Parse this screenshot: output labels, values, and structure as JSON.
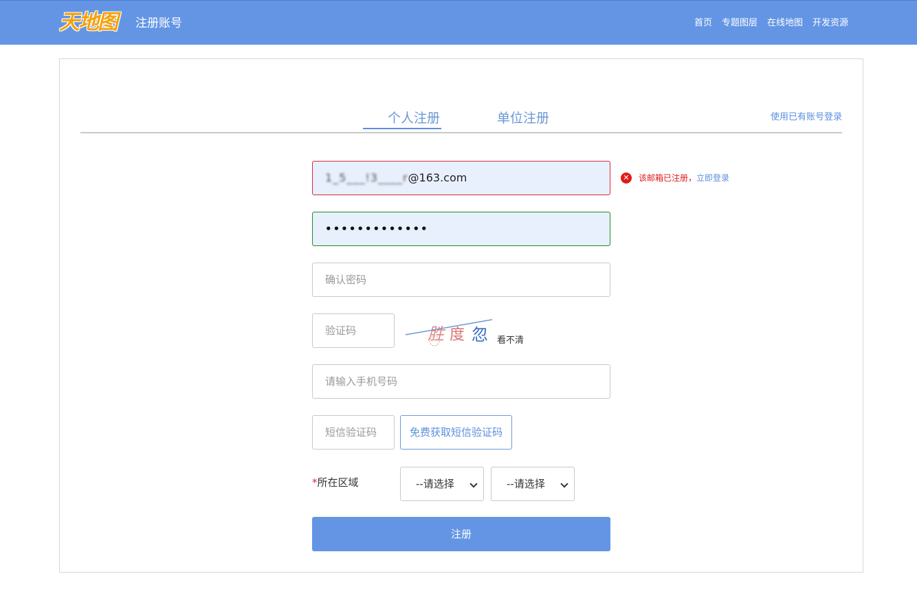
{
  "header": {
    "logo_text": "天地图",
    "title": "注册账号",
    "nav": [
      "首页",
      "专题图层",
      "在线地图",
      "开发资源"
    ]
  },
  "tabs": {
    "personal": "个人注册",
    "unit": "单位注册",
    "login_link": "使用已有账号登录"
  },
  "form": {
    "email_value_hidden": "1_5___!3____r",
    "email_value_suffix": "@163.com",
    "email_error": "该邮箱已注册，",
    "email_error_link": "立即登录",
    "password_value": "•••••••••••••",
    "confirm_password_placeholder": "确认密码",
    "captcha_placeholder": "验证码",
    "captcha_text": "胜度忽",
    "captcha_refresh": "看不清",
    "phone_placeholder": "请输入手机号码",
    "sms_code_placeholder": "短信验证码",
    "sms_button": "免费获取短信验证码",
    "region_star": "*",
    "region_label": "所在区域",
    "province_select": "--请选择",
    "city_select": "--请选择",
    "submit": "注册"
  },
  "colors": {
    "header_bg": "#6395e4",
    "accent": "#5b8fde",
    "error": "#e01b1b",
    "success_border": "#1d8a2a"
  }
}
